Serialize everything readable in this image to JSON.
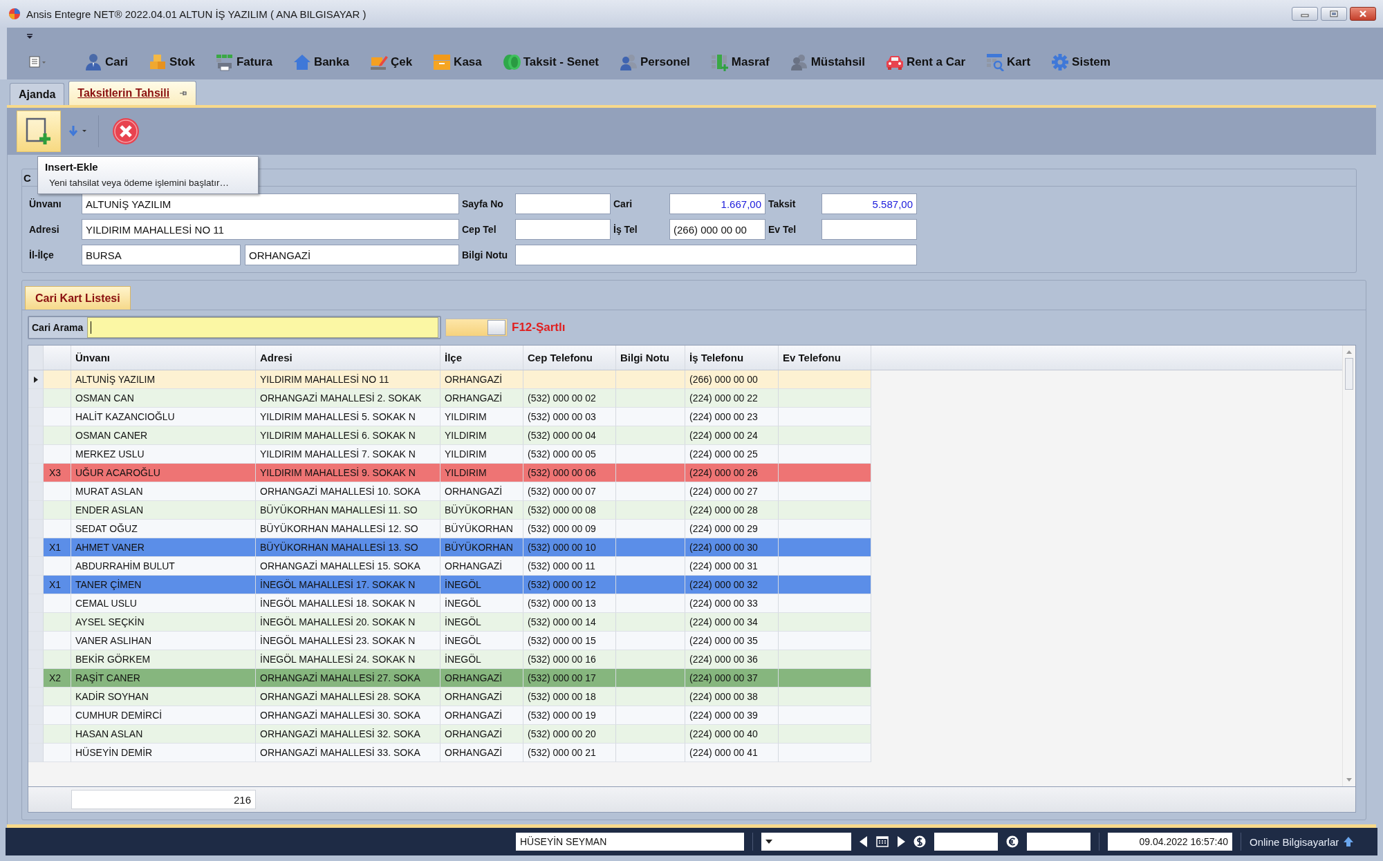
{
  "window": {
    "title": "Ansis Entegre NET® 2022.04.01 ALTUN İŞ YAZILIM ( ANA BILGISAYAR )"
  },
  "ribbon": [
    {
      "label": "Cari"
    },
    {
      "label": "Stok"
    },
    {
      "label": "Fatura"
    },
    {
      "label": "Banka"
    },
    {
      "label": "Çek"
    },
    {
      "label": "Kasa"
    },
    {
      "label": "Taksit - Senet"
    },
    {
      "label": "Personel"
    },
    {
      "label": "Masraf"
    },
    {
      "label": "Müstahsil"
    },
    {
      "label": "Rent a Car"
    },
    {
      "label": "Kart"
    },
    {
      "label": "Sistem"
    }
  ],
  "tabs": [
    {
      "label": "Ajanda",
      "selected": false
    },
    {
      "label": "Taksitlerin Tahsili",
      "selected": true
    }
  ],
  "tooltip": {
    "title": "Insert-Ekle",
    "text": "Yeni tahsilat veya ödeme işlemini başlatır…"
  },
  "customer_form": {
    "caption": "C",
    "fields": [
      {
        "label": "Ünvanı",
        "kind": "text",
        "value": "ALTUNİŞ YAZILIM"
      },
      {
        "label": "Sayfa No",
        "kind": "text"
      },
      {
        "label": "Cari",
        "kind": "amount",
        "value": "1.667,00"
      },
      {
        "label": "Taksit",
        "kind": "amount",
        "value": "5.587,00"
      },
      {
        "label": "Adresi",
        "kind": "text",
        "value": "YILDIRIM  MAHALLESİ NO 11"
      },
      {
        "label": "Cep Tel",
        "kind": "text"
      },
      {
        "label": "İş Tel",
        "kind": "text",
        "value": "(266) 000 00 00"
      },
      {
        "label": "Ev Tel",
        "kind": "text"
      },
      {
        "label": "İl-İlçe",
        "kind": "pair",
        "values": [
          "BURSA",
          "ORHANGAZİ"
        ]
      },
      {
        "label": "Bilgi Notu",
        "kind": "note"
      }
    ]
  },
  "list_tab": {
    "label": "Cari Kart Listesi"
  },
  "search": {
    "label": "Cari Arama",
    "hint": "F12-Şartlı"
  },
  "table": {
    "columns": [
      "Ünvanı",
      "Adresi",
      "İlçe",
      "Cep Telefonu",
      "Bilgi Notu",
      "İş Telefonu",
      "Ev Telefonu"
    ],
    "rows": [
      {
        "selected": true,
        "title": "ALTUNİŞ YAZILIM",
        "address": "YILDIRIM  MAHALLESİ NO 11",
        "district": "ORHANGAZİ",
        "work_phone": "(266) 000 00 00"
      },
      {
        "selected": false,
        "title": "OSMAN CAN",
        "address": "ORHANGAZİ MAHALLESİ 2. SOKAK",
        "district": "ORHANGAZİ",
        "mobile": "(532) 000 00 02",
        "work_phone": "(224) 000 00 22"
      },
      {
        "selected": false,
        "title": "HALİT KAZANCIOĞLU",
        "address": "YILDIRIM MAHALLESİ 5. SOKAK N",
        "district": "YILDIRIM",
        "mobile": "(532) 000 00 03",
        "work_phone": "(224) 000 00 23"
      },
      {
        "selected": false,
        "title": "OSMAN  CANER",
        "address": "YILDIRIM MAHALLESİ 6. SOKAK N",
        "district": "YILDIRIM",
        "mobile": "(532) 000 00 04",
        "work_phone": "(224) 000 00 24"
      },
      {
        "selected": false,
        "title": "MERKEZ USLU",
        "address": "YILDIRIM MAHALLESİ 7. SOKAK N",
        "district": "YILDIRIM",
        "mobile": "(532) 000 00 05",
        "work_phone": "(224) 000 00 25"
      },
      {
        "selected": false,
        "mark": "X3",
        "color": "#ee7474",
        "title": "UĞUR ACAROĞLU",
        "address": "YILDIRIM MAHALLESİ 9. SOKAK N",
        "district": "YILDIRIM",
        "mobile": "(532) 000 00 06",
        "work_phone": "(224) 000 00 26"
      },
      {
        "selected": false,
        "title": "MURAT ASLAN",
        "address": "ORHANGAZİ MAHALLESİ 10. SOKA",
        "district": "ORHANGAZİ",
        "mobile": "(532) 000 00 07",
        "work_phone": "(224) 000 00 27"
      },
      {
        "selected": false,
        "title": "ENDER ASLAN",
        "address": "BÜYÜKORHAN MAHALLESİ 11. SO",
        "district": "BÜYÜKORHAN",
        "mobile": "(532) 000 00 08",
        "work_phone": "(224) 000 00 28"
      },
      {
        "selected": false,
        "title": "SEDAT OĞUZ",
        "address": "BÜYÜKORHAN MAHALLESİ 12. SO",
        "district": "BÜYÜKORHAN",
        "mobile": "(532) 000 00 09",
        "work_phone": "(224) 000 00 29"
      },
      {
        "selected": false,
        "mark": "X1",
        "color": "#5b8ee8",
        "title": "AHMET VANER",
        "address": "BÜYÜKORHAN MAHALLESİ 13. SO",
        "district": "BÜYÜKORHAN",
        "mobile": "(532) 000 00 10",
        "work_phone": "(224) 000 00 30"
      },
      {
        "selected": false,
        "title": "ABDURRAHİM BULUT",
        "address": "ORHANGAZİ MAHALLESİ 15. SOKA",
        "district": "ORHANGAZİ",
        "mobile": "(532) 000 00 11",
        "work_phone": "(224) 000 00 31"
      },
      {
        "selected": false,
        "mark": "X1",
        "color": "#5b8ee8",
        "title": "TANER ÇİMEN",
        "address": "İNEGÖL MAHALLESİ 17. SOKAK N",
        "district": "İNEGÖL",
        "mobile": "(532) 000 00 12",
        "work_phone": "(224) 000 00 32"
      },
      {
        "selected": false,
        "title": "CEMAL  USLU",
        "address": "İNEGÖL MAHALLESİ 18. SOKAK N",
        "district": "İNEGÖL",
        "mobile": "(532) 000 00 13",
        "work_phone": "(224) 000 00 33"
      },
      {
        "selected": false,
        "title": "AYSEL SEÇKİN",
        "address": "İNEGÖL MAHALLESİ 20. SOKAK N",
        "district": "İNEGÖL",
        "mobile": "(532) 000 00 14",
        "work_phone": "(224) 000 00 34"
      },
      {
        "selected": false,
        "title": "VANER ASLIHAN",
        "address": "İNEGÖL MAHALLESİ 23. SOKAK N",
        "district": "İNEGÖL",
        "mobile": "(532) 000 00 15",
        "work_phone": "(224) 000 00 35"
      },
      {
        "selected": false,
        "title": "BEKİR GÖRKEM",
        "address": "İNEGÖL MAHALLESİ 24. SOKAK N",
        "district": "İNEGÖL",
        "mobile": "(532) 000 00 16",
        "work_phone": "(224) 000 00 36"
      },
      {
        "selected": false,
        "mark": "X2",
        "color": "#86b67e",
        "title": "RAŞİT CANER",
        "address": "ORHANGAZİ MAHALLESİ 27. SOKA",
        "district": "ORHANGAZİ",
        "mobile": "(532) 000 00 17",
        "work_phone": "(224) 000 00 37"
      },
      {
        "selected": false,
        "title": "KADİR SOYHAN",
        "address": "ORHANGAZİ MAHALLESİ 28. SOKA",
        "district": "ORHANGAZİ",
        "mobile": "(532) 000 00 18",
        "work_phone": "(224) 000 00 38"
      },
      {
        "selected": false,
        "title": "CUMHUR DEMİRCİ",
        "address": "ORHANGAZİ MAHALLESİ 30. SOKA",
        "district": "ORHANGAZİ",
        "mobile": "(532) 000 00 19",
        "work_phone": "(224) 000 00 39"
      },
      {
        "selected": false,
        "title": "HASAN ASLAN",
        "address": "ORHANGAZİ MAHALLESİ 32. SOKA",
        "district": "ORHANGAZİ",
        "mobile": "(532) 000 00 20",
        "work_phone": "(224) 000 00 40"
      },
      {
        "selected": false,
        "title": "HÜSEYİN DEMİR",
        "address": "ORHANGAZİ MAHALLESİ 33. SOKA",
        "district": "ORHANGAZİ",
        "mobile": "(532) 000 00 21",
        "work_phone": "(224) 000 00 41"
      }
    ],
    "row_count": "216"
  },
  "status_bar": {
    "user": "HÜSEYİN SEYMAN",
    "datetime": "09.04.2022 16:57:40",
    "online": "Online Bilgisayarlar"
  }
}
